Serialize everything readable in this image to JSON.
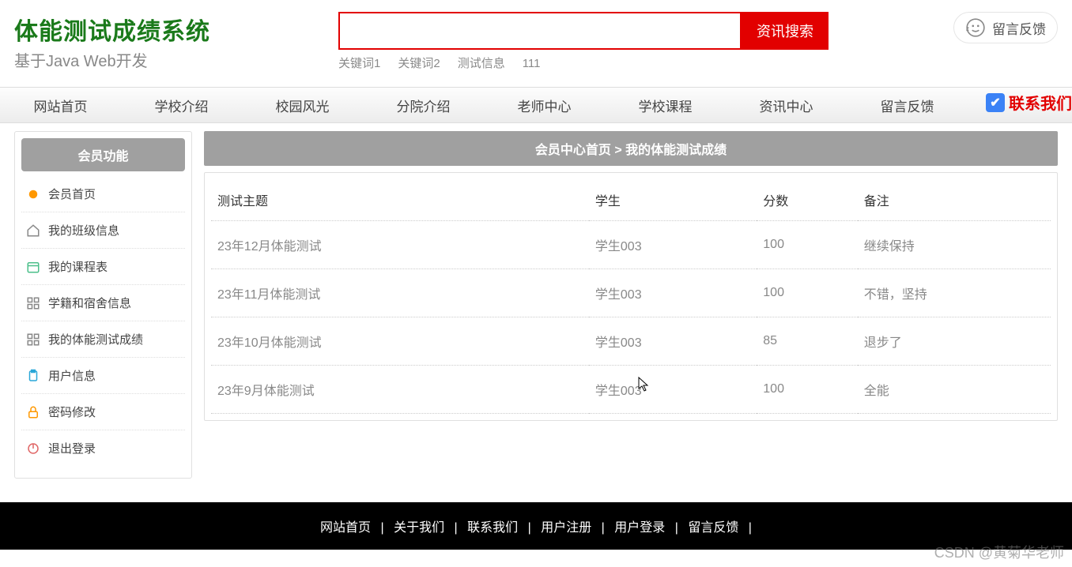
{
  "header": {
    "title": "体能测试成绩系统",
    "subtitle": "基于Java Web开发",
    "searchBtn": "资讯搜索",
    "keywords": [
      "关键词1",
      "关键词2",
      "测试信息",
      "111"
    ],
    "feedback": "留言反馈"
  },
  "nav": {
    "items": [
      "网站首页",
      "学校介绍",
      "校园风光",
      "分院介绍",
      "老师中心",
      "学校课程",
      "资讯中心",
      "留言反馈"
    ],
    "contact": "联系我们"
  },
  "sidebar": {
    "title": "会员功能",
    "items": [
      {
        "label": "会员首页",
        "icon": "dot-orange"
      },
      {
        "label": "我的班级信息",
        "icon": "home"
      },
      {
        "label": "我的课程表",
        "icon": "calendar"
      },
      {
        "label": "学籍和宿舍信息",
        "icon": "grid"
      },
      {
        "label": "我的体能测试成绩",
        "icon": "grid"
      },
      {
        "label": "用户信息",
        "icon": "clipboard"
      },
      {
        "label": "密码修改",
        "icon": "lock"
      },
      {
        "label": "退出登录",
        "icon": "power"
      }
    ]
  },
  "main": {
    "breadcrumb": "会员中心首页 > 我的体能测试成绩",
    "columns": [
      "测试主题",
      "学生",
      "分数",
      "备注"
    ],
    "rows": [
      {
        "topic": "23年12月体能测试",
        "student": "学生003",
        "score": "100",
        "remark": "继续保持"
      },
      {
        "topic": "23年11月体能测试",
        "student": "学生003",
        "score": "100",
        "remark": "不错，坚持"
      },
      {
        "topic": "23年10月体能测试",
        "student": "学生003",
        "score": "85",
        "remark": "退步了"
      },
      {
        "topic": "23年9月体能测试",
        "student": "学生003",
        "score": "100",
        "remark": "全能"
      }
    ]
  },
  "footer": {
    "links": [
      "网站首页",
      "关于我们",
      "联系我们",
      "用户注册",
      "用户登录",
      "留言反馈"
    ]
  },
  "watermark": "CSDN @黄菊华老师"
}
